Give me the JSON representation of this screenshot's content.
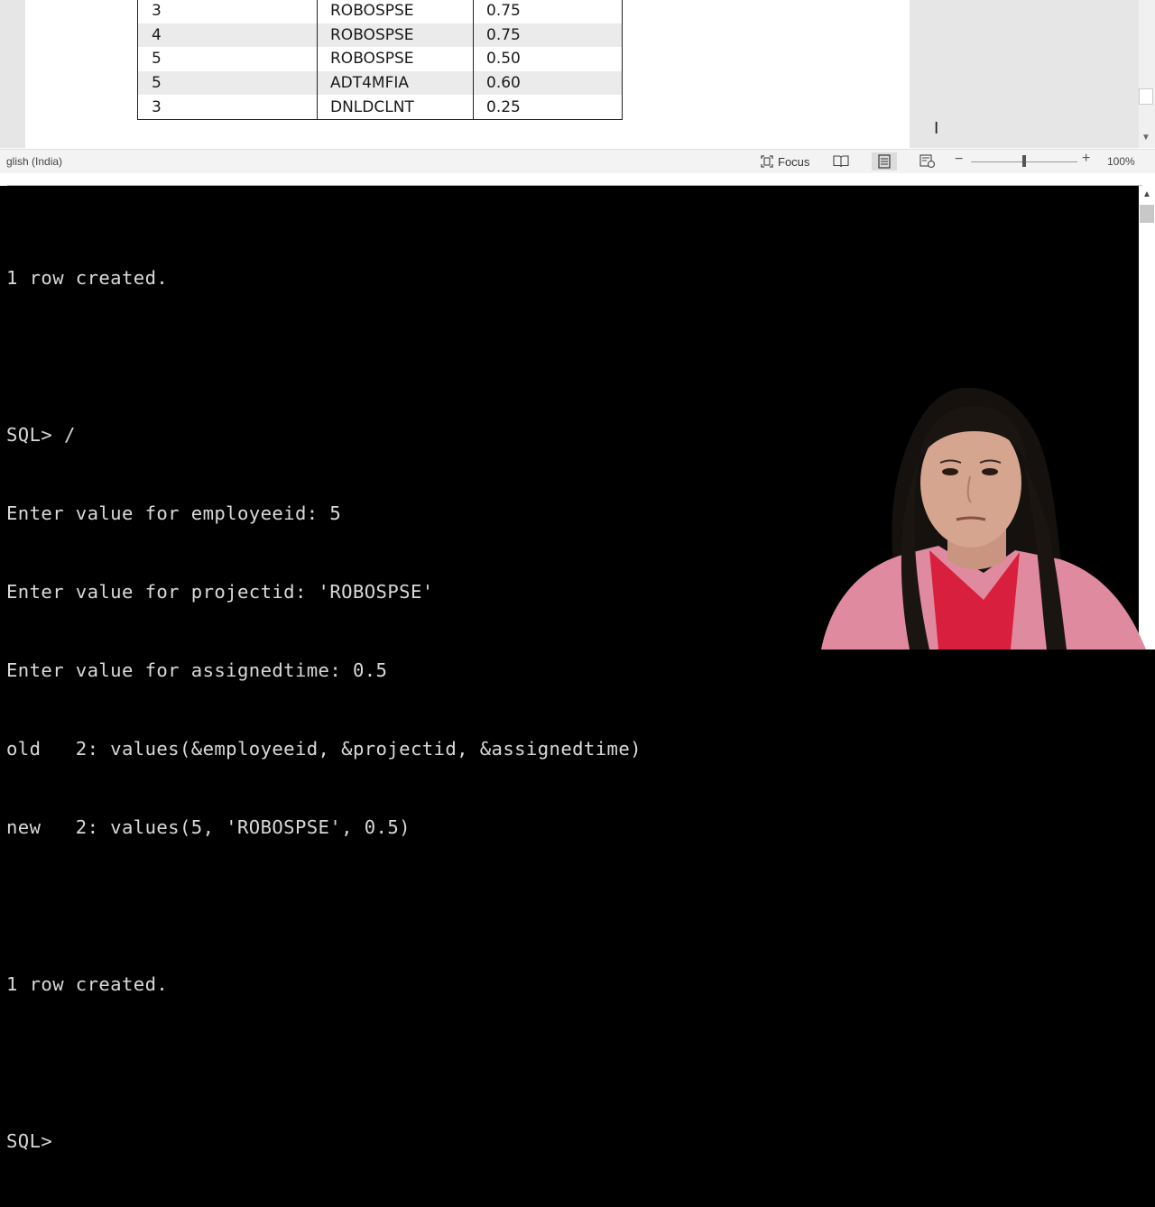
{
  "document": {
    "table_rows": [
      {
        "employeeid": "3",
        "projectid": "ROBOSPSE",
        "assignedtime": "0.75"
      },
      {
        "employeeid": "4",
        "projectid": "ROBOSPSE",
        "assignedtime": "0.75"
      },
      {
        "employeeid": "5",
        "projectid": "ROBOSPSE",
        "assignedtime": "0.50"
      },
      {
        "employeeid": "5",
        "projectid": "ADT4MFIA",
        "assignedtime": "0.60"
      },
      {
        "employeeid": "3",
        "projectid": "DNLDCLNT",
        "assignedtime": "0.25"
      }
    ]
  },
  "statusbar": {
    "language": "glish (India)",
    "focus_label": "Focus",
    "zoom_level": "100%",
    "zoom_fraction": 0.5
  },
  "console": {
    "lines": [
      "1 row created.",
      "",
      "SQL> /",
      "Enter value for employeeid: 5",
      "Enter value for projectid: 'ROBOSPSE'",
      "Enter value for assignedtime: 0.5",
      "old   2: values(&employeeid, &projectid, &assignedtime)",
      "new   2: values(5, 'ROBOSPSE', 0.5)",
      "",
      "1 row created.",
      "",
      "SQL>"
    ]
  },
  "colors": {
    "console_bg": "#000000",
    "console_fg": "#d9d9d9",
    "table_alt_row": "#ebebeb",
    "presenter_top": "#e8889f"
  }
}
